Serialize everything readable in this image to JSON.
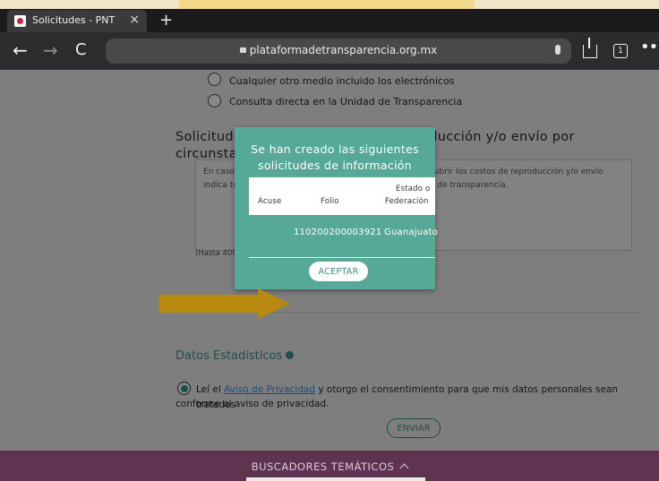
{
  "browser": {
    "tab_title": "Solicitudes - PNT",
    "url": "plataformadetransparencia.org.mx",
    "tab_count": "1"
  },
  "form": {
    "option_other_media": "Cualquier otro medio incluido los electrónicos",
    "option_direct": "Consulta directa en la Unidad de Transparencia",
    "exempt_title": "Solicitud para exentar pago por reproducción y/o envío por circunstancias socioeconómicas",
    "exempt_placeholder": "En caso de considerar que no estás en posibilidades de cubrir los costos de reproducción y/o envío indica tus razones para que sean valoradas por la unidad de transparencia.",
    "char_hint": "(Hasta 400",
    "datos_title": "Datos Estadísticos",
    "aviso_prefix": "Leí el ",
    "aviso_link": "Aviso de Privacidad",
    "aviso_suffix": " y otorgo el consentimiento para que mis datos personales sean tratados",
    "aviso_line2": "conforme al aviso de privacidad.",
    "enviar": "ENVIAR"
  },
  "footer": {
    "buscadores": "BUSCADORES TEMÁTICOS"
  },
  "modal": {
    "title": "Se han creado las siguientes solicitudes de información",
    "col_acuse": "Acuse",
    "col_folio": "Folio",
    "col_estado_1": "Estado o",
    "col_estado_2": "Federación",
    "row_folio": "110200200003921",
    "row_estado": "Guanajuato",
    "aceptar": "ACEPTAR"
  },
  "colors": {
    "modal": "#56a897",
    "arrow": "#b78a0f",
    "footer": "#5e3450"
  }
}
